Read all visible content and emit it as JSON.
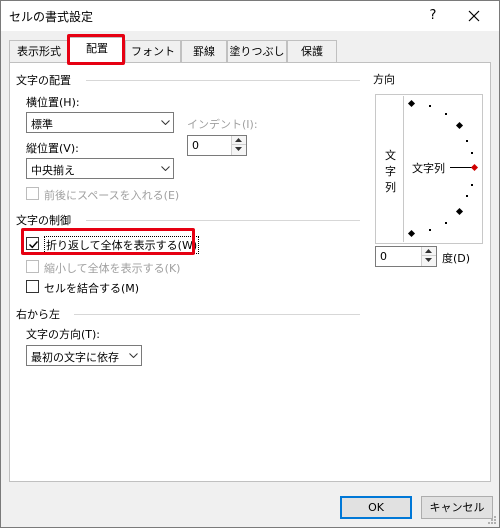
{
  "window": {
    "title": "セルの書式設定",
    "help_glyph": "?"
  },
  "tabs": [
    {
      "label": "表示形式"
    },
    {
      "label": "配置"
    },
    {
      "label": "フォント"
    },
    {
      "label": "罫線"
    },
    {
      "label": "塗りつぶし"
    },
    {
      "label": "保護"
    }
  ],
  "text_alignment": {
    "heading": "文字の配置",
    "horizontal_label": "横位置(H):",
    "horizontal_value": "標準",
    "indent_label": "インデント(I):",
    "indent_value": "0",
    "vertical_label": "縦位置(V):",
    "vertical_value": "中央揃え",
    "justify_distributed_label": "前後にスペースを入れる(E)"
  },
  "text_control": {
    "heading": "文字の制御",
    "wrap_text_label": "折り返して全体を表示する(W)",
    "wrap_text_checked": true,
    "shrink_to_fit_label": "縮小して全体を表示する(K)",
    "merge_cells_label": "セルを結合する(M)"
  },
  "rtl": {
    "heading": "右から左",
    "direction_label": "文字の方向(T):",
    "direction_value": "最初の文字に依存"
  },
  "orientation": {
    "heading": "方向",
    "vertical_text": [
      "文",
      "字",
      "列"
    ],
    "dial_text": "文字列",
    "degrees_value": "0",
    "degrees_label": "度(D)"
  },
  "footer": {
    "ok_label": "OK",
    "cancel_label": "キャンセル"
  },
  "colors": {
    "highlight": "#e60012",
    "accent": "#0078d7"
  }
}
